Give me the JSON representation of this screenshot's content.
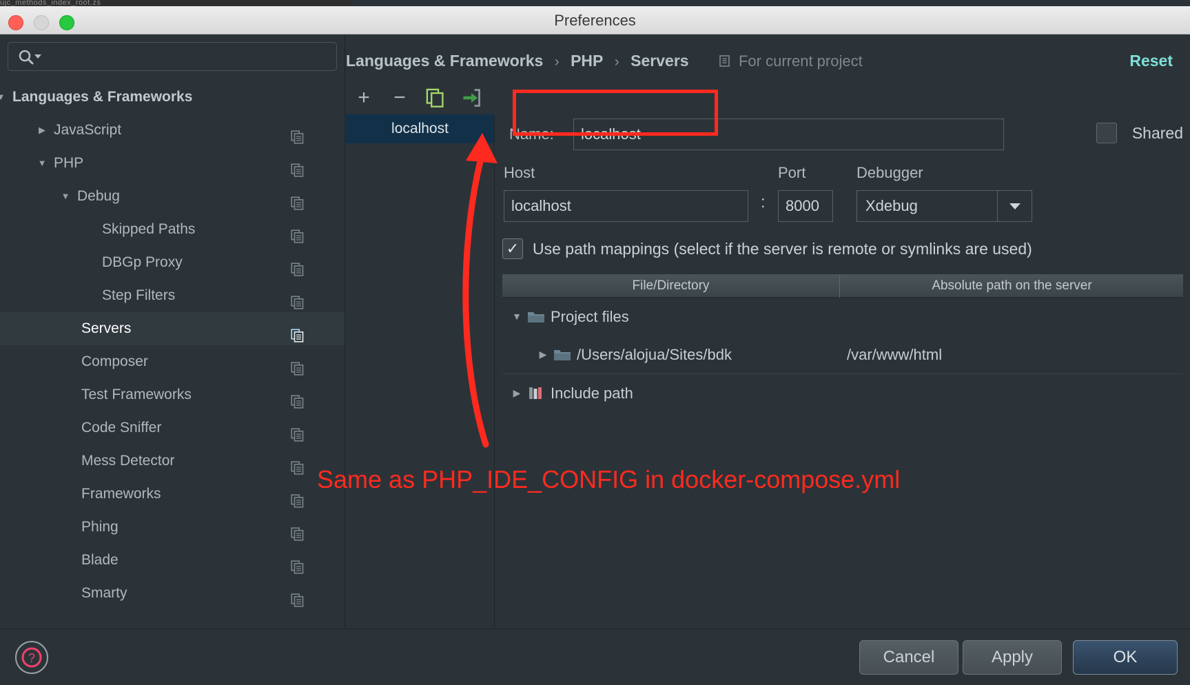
{
  "window": {
    "title": "Preferences",
    "sliver_text": "ujc_methods_index_root.zs",
    "traffic_lights": [
      "close-red",
      "minimize-yellow",
      "zoom-green"
    ]
  },
  "sidebar": {
    "search": {
      "value": "",
      "placeholder": ""
    },
    "items": [
      {
        "label": "Languages & Frameworks",
        "indent": 18,
        "twisty": "down",
        "bold": true,
        "selected": false,
        "copy": false
      },
      {
        "label": "JavaScript",
        "indent": 78,
        "twisty": "right",
        "bold": false,
        "selected": false,
        "copy": true
      },
      {
        "label": "PHP",
        "indent": 78,
        "twisty": "down",
        "bold": false,
        "selected": false,
        "copy": true
      },
      {
        "label": "Debug",
        "indent": 112,
        "twisty": "down",
        "bold": false,
        "selected": false,
        "copy": true
      },
      {
        "label": "Skipped Paths",
        "indent": 148,
        "twisty": "none",
        "bold": false,
        "selected": false,
        "copy": true
      },
      {
        "label": "DBGp Proxy",
        "indent": 148,
        "twisty": "none",
        "bold": false,
        "selected": false,
        "copy": true
      },
      {
        "label": "Step Filters",
        "indent": 148,
        "twisty": "none",
        "bold": false,
        "selected": false,
        "copy": true
      },
      {
        "label": "Servers",
        "indent": 118,
        "twisty": "none",
        "bold": false,
        "selected": true,
        "copy": true
      },
      {
        "label": "Composer",
        "indent": 118,
        "twisty": "none",
        "bold": false,
        "selected": false,
        "copy": true
      },
      {
        "label": "Test Frameworks",
        "indent": 118,
        "twisty": "none",
        "bold": false,
        "selected": false,
        "copy": true
      },
      {
        "label": "Code Sniffer",
        "indent": 118,
        "twisty": "none",
        "bold": false,
        "selected": false,
        "copy": true
      },
      {
        "label": "Mess Detector",
        "indent": 118,
        "twisty": "none",
        "bold": false,
        "selected": false,
        "copy": true
      },
      {
        "label": "Frameworks",
        "indent": 118,
        "twisty": "none",
        "bold": false,
        "selected": false,
        "copy": true
      },
      {
        "label": "Phing",
        "indent": 118,
        "twisty": "none",
        "bold": false,
        "selected": false,
        "copy": true
      },
      {
        "label": "Blade",
        "indent": 118,
        "twisty": "none",
        "bold": false,
        "selected": false,
        "copy": true
      },
      {
        "label": "Smarty",
        "indent": 118,
        "twisty": "none",
        "bold": false,
        "selected": false,
        "copy": true
      }
    ]
  },
  "breadcrumb": {
    "crumb1": "Languages & Frameworks",
    "sep1": "›",
    "crumb2": "PHP",
    "sep2": "›",
    "crumb3": "Servers",
    "scope": "For current project",
    "reset": "Reset"
  },
  "list_toolbar": {
    "add": "+",
    "remove": "−",
    "copy": "copy-icon",
    "import": "import-icon"
  },
  "server_list": {
    "items": [
      {
        "label": "localhost",
        "selected": true
      }
    ]
  },
  "form": {
    "name_label": "Name:",
    "name_value": "localhost",
    "shared_label": "Shared",
    "shared_checked": false,
    "host_label": "Host",
    "host_value": "localhost",
    "colon": ":",
    "port_label": "Port",
    "port_value": "8000",
    "debugger_label": "Debugger",
    "debugger_value": "Xdebug",
    "path_mappings_label": "Use path mappings (select if the server is remote or symlinks are used)",
    "path_mappings_checked": true,
    "check_mark": "✓",
    "table": {
      "headers": [
        "File/Directory",
        "Absolute path on the server"
      ],
      "rows": [
        {
          "indent": 10,
          "twisty": "down",
          "icon": "folder-icon",
          "name": "Project files",
          "abs": ""
        },
        {
          "indent": 48,
          "twisty": "right",
          "icon": "folder-icon",
          "name": "/Users/alojua/Sites/bdk",
          "abs": "/var/www/html"
        },
        {
          "indent": 10,
          "twisty": "right",
          "icon": "include-path-icon",
          "name": "Include path",
          "abs": ""
        }
      ]
    }
  },
  "annotations": {
    "note_text": "Same as PHP_IDE_CONFIG in docker-compose.yml",
    "highlight_color": "#ff2a1f"
  },
  "footer": {
    "help": "?",
    "cancel": "Cancel",
    "apply": "Apply",
    "ok": "OK"
  }
}
